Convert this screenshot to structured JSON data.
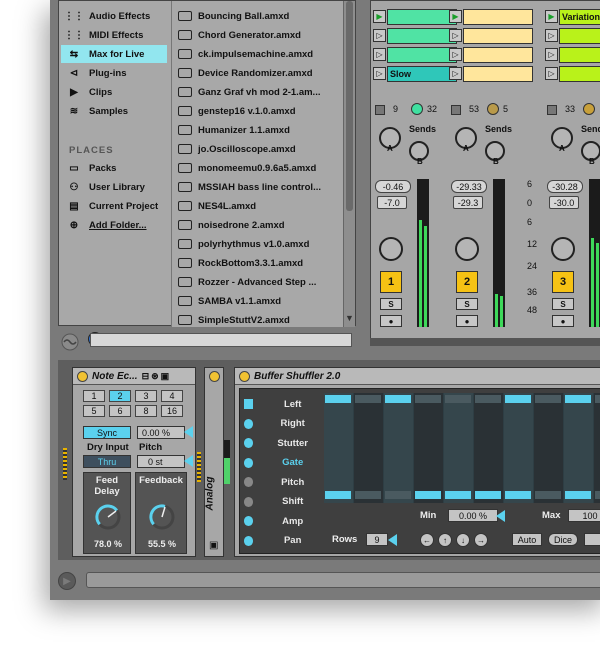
{
  "browser": {
    "categories": [
      {
        "label": "Audio Effects",
        "icon": "audio-effects-icon",
        "glyph": "⋮⋮"
      },
      {
        "label": "MIDI Effects",
        "icon": "midi-effects-icon",
        "glyph": "⋮⋮"
      },
      {
        "label": "Max for Live",
        "icon": "max-for-live-icon",
        "glyph": "⇆",
        "selected": true
      },
      {
        "label": "Plug-ins",
        "icon": "plugin-icon",
        "glyph": "⊲"
      },
      {
        "label": "Clips",
        "icon": "clips-icon",
        "glyph": "▶"
      },
      {
        "label": "Samples",
        "icon": "samples-icon",
        "glyph": "≋"
      }
    ],
    "places_header": "PLACES",
    "places": [
      {
        "label": "Packs",
        "icon": "packs-icon",
        "glyph": "▭"
      },
      {
        "label": "User Library",
        "icon": "user-library-icon",
        "glyph": "⚇"
      },
      {
        "label": "Current Project",
        "icon": "current-project-icon",
        "glyph": "▤"
      },
      {
        "label": "Add Folder...",
        "icon": "add-folder-icon",
        "glyph": "⊕"
      }
    ],
    "files": [
      "Bouncing Ball.amxd",
      "Chord Generator.amxd",
      "ck.impulsemachine.amxd",
      "Device Randomizer.amxd",
      "Ganz Graf vh mod 2-1.am...",
      "genstep16 v.1.0.amxd",
      "Humanizer 1.1.amxd",
      "jo.Oscilloscope.amxd",
      "monomeemu0.9.6a5.amxd",
      "MSSIAH bass line control...",
      "NES4L.amxd",
      "noisedrone 2.amxd",
      "polyrhythmus v1.0.amxd",
      "RockBottom3.3.1.amxd",
      "Rozzer - Advanced Step ...",
      "SAMBA v1.1.amxd",
      "SimpleStuttV2.amxd"
    ]
  },
  "session": {
    "clip_variation": "Variation",
    "clip_slow": "Slow",
    "tracks": [
      {
        "send_a_val": "9",
        "send_b_val": "32",
        "vol": "-0.46",
        "pan": "-7.0",
        "num": "1",
        "solo": "S"
      },
      {
        "send_a_val": "53",
        "send_b_val": "5",
        "vol": "-29.33",
        "pan": "-29.3",
        "num": "2",
        "solo": "S"
      },
      {
        "send_a_val": "33",
        "send_b_val": "",
        "vol": "-30.28",
        "pan": "-30.0",
        "num": "3",
        "solo": "S"
      }
    ],
    "sends_label": "Sends",
    "knob_a": "A",
    "knob_b": "B",
    "db_scale": [
      "6",
      "0",
      "6",
      "12",
      "24",
      "36",
      "48"
    ]
  },
  "note_echo": {
    "title": "Note Ec...",
    "buttons": [
      "1",
      "2",
      "3",
      "4",
      "5",
      "6",
      "8",
      "16"
    ],
    "selected": "2",
    "sync": "Sync",
    "sync_value": "0.00 %",
    "dry_input": "Dry Input",
    "pitch": "Pitch",
    "thru": "Thru",
    "pitch_value": "0 st",
    "feed_delay": "Feed Delay",
    "feedback": "Feedback",
    "feed_delay_value": "78.0 %",
    "feedback_value": "55.5 %"
  },
  "analog_label": "Analog",
  "shuffler": {
    "title": "Buffer Shuffler 2.0",
    "rows": [
      "Left",
      "Right",
      "Stutter",
      "Gate",
      "Pitch",
      "Shift",
      "Amp",
      "Pan"
    ],
    "min_label": "Min",
    "min_value": "0.00 %",
    "max_label": "Max",
    "max_value": "100",
    "rows_label": "Rows",
    "rows_value": "9",
    "auto": "Auto",
    "dice": "Dice"
  },
  "colors": {
    "accent": "#5bd1ee",
    "clip_green": "#50e3a4",
    "clip_yellow": "#ffe69c",
    "clip_lime": "#b9f21a",
    "track_yellow": "#f6c214"
  }
}
